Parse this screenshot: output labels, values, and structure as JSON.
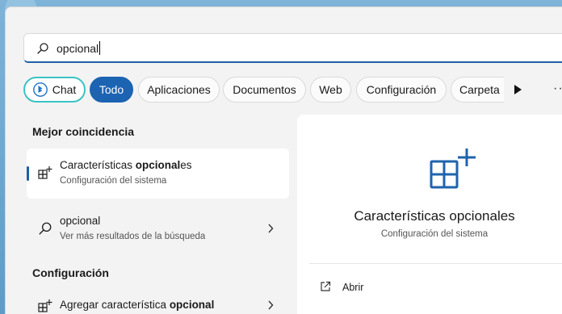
{
  "search": {
    "value": "opcional",
    "icon": "search-icon"
  },
  "chips": {
    "chat": "Chat",
    "todo": "Todo",
    "aplicaciones": "Aplicaciones",
    "documentos": "Documentos",
    "web": "Web",
    "configuracion": "Configuración",
    "carpetas": "Carpeta",
    "more_dots": "···",
    "active_color": "#1c63b2",
    "chat_border_color": "#3bc3c4"
  },
  "left": {
    "best_match_title": "Mejor coincidencia",
    "best_item": {
      "title_pre": "Características ",
      "title_bold": "opcional",
      "title_post": "es",
      "subtitle": "Configuración del sistema",
      "icon": "optional-features-icon"
    },
    "web_item": {
      "title": "opcional",
      "subtitle": "Ver más resultados de la búsqueda",
      "icon": "search-icon"
    },
    "settings_title": "Configuración",
    "settings_item": {
      "title_pre": "Agregar característica ",
      "title_bold": "opcional",
      "icon": "optional-features-icon"
    }
  },
  "right": {
    "title": "Características opcionales",
    "subtitle": "Configuración del sistema",
    "open_label": "Abrir",
    "accent_color": "#1f63ad"
  }
}
